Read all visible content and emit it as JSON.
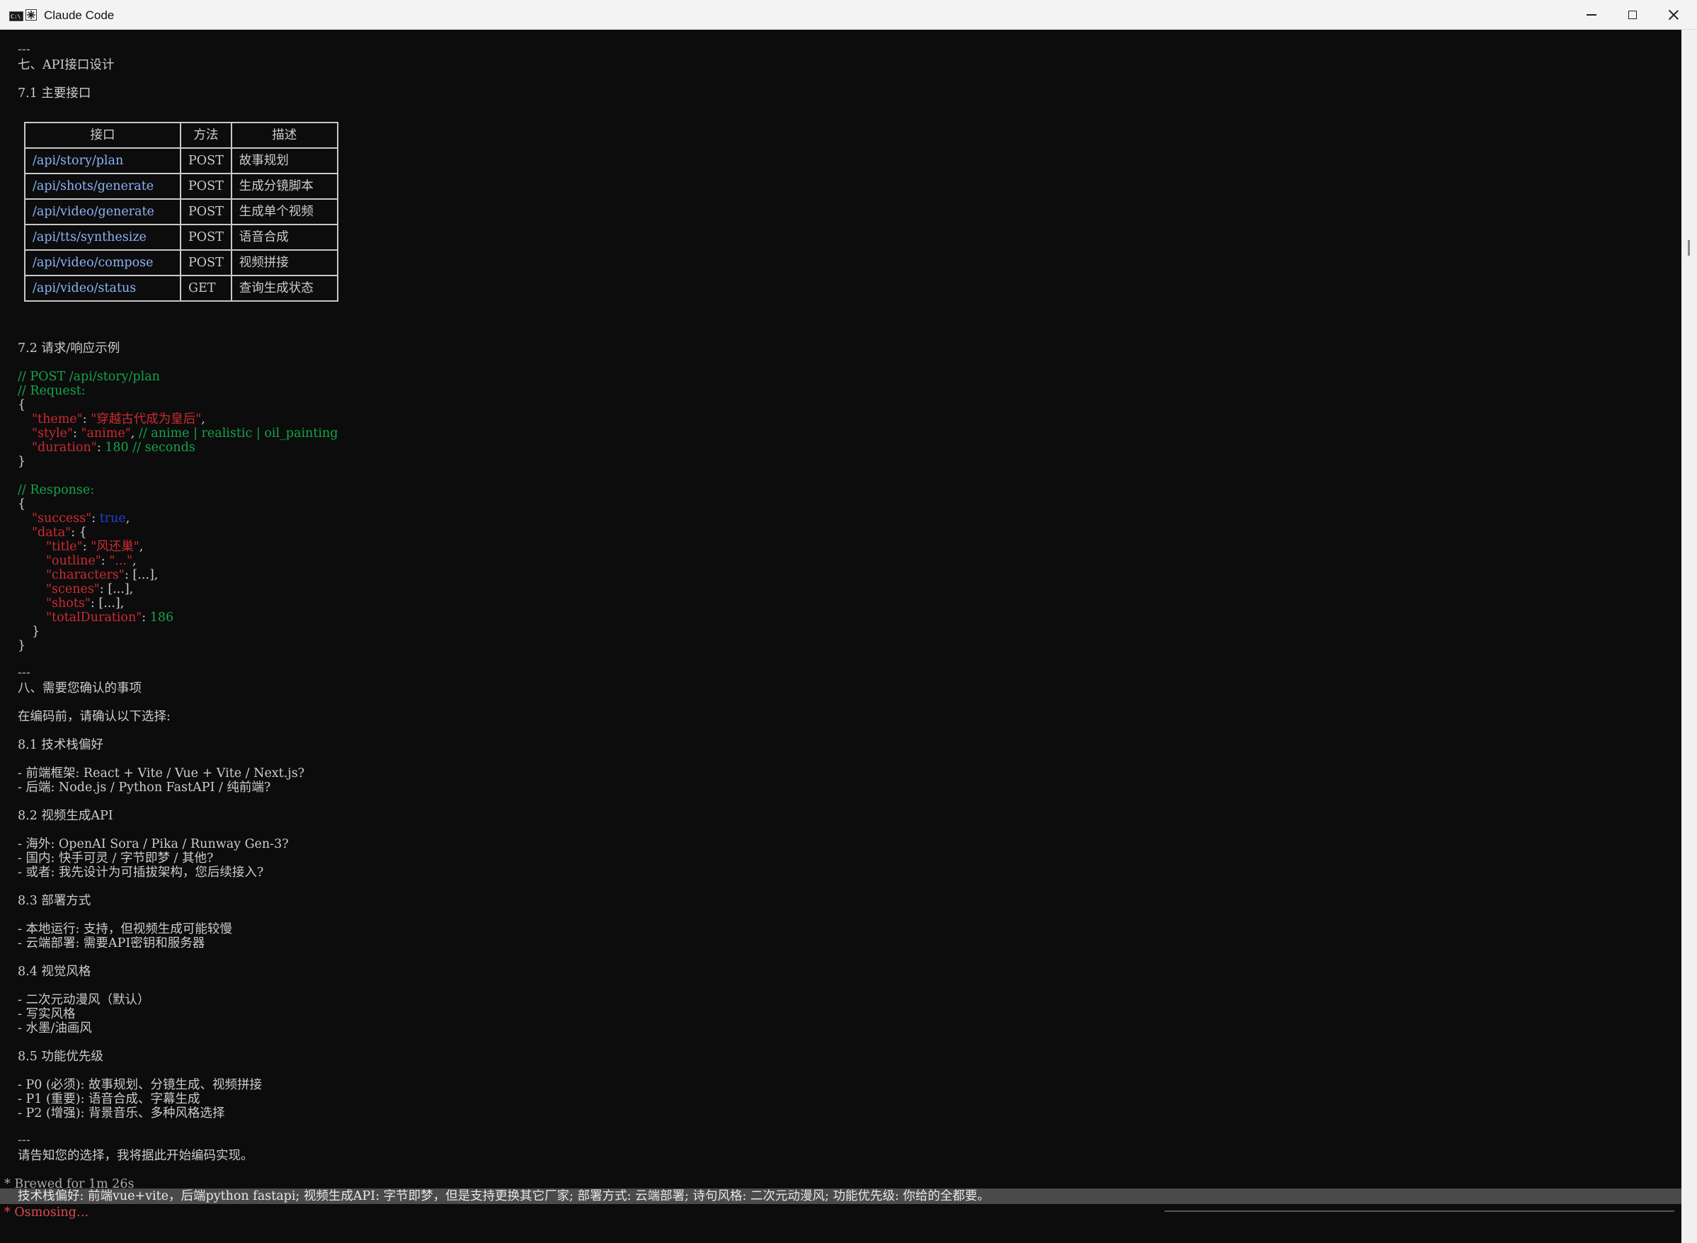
{
  "window": {
    "title": "Claude Code",
    "app_icon": "cmd-icon",
    "logo_icon": "sparkle-icon"
  },
  "lines": {
    "hr1": "---",
    "sec7": "七、API接口设计",
    "sec71": "7.1 主要接口",
    "sec72": "7.2 请求/响应示例",
    "hr2": "---",
    "sec8": "八、需要您确认的事项",
    "intro8": "在编码前，请确认以下选择:",
    "sec81": "8.1 技术栈偏好",
    "l81a": "- 前端框架: React + Vite / Vue + Vite / Next.js?",
    "l81b": "- 后端: Node.js / Python FastAPI / 纯前端?",
    "sec82": "8.2 视频生成API",
    "l82a": "- 海外: OpenAI Sora / Pika / Runway Gen-3?",
    "l82b": "- 国内: 快手可灵 / 字节即梦 / 其他?",
    "l82c": "- 或者: 我先设计为可插拔架构，您后续接入?",
    "sec83": "8.3 部署方式",
    "l83a": "- 本地运行: 支持，但视频生成可能较慢",
    "l83b": "- 云端部署: 需要API密钥和服务器",
    "sec84": "8.4 视觉风格",
    "l84a": "- 二次元动漫风（默认）",
    "l84b": "- 写实风格",
    "l84c": "- 水墨/油画风",
    "sec85": "8.5 功能优先级",
    "l85a": "- P0 (必须): 故事规划、分镜生成、视频拼接",
    "l85b": "- P1 (重要): 语音合成、字幕生成",
    "l85c": "- P2 (增强): 背景音乐、多种风格选择",
    "hr3": "---",
    "closing": "请告知您的选择，我将据此开始编码实现。",
    "brewed": "Brewed for 1m 26s",
    "status": "Osmosing…"
  },
  "table": {
    "headers": [
      "接口",
      "方法",
      "描述"
    ],
    "rows": [
      [
        "/api/story/plan",
        "POST",
        "故事规划"
      ],
      [
        "/api/shots/generate",
        "POST",
        "生成分镜脚本"
      ],
      [
        "/api/video/generate",
        "POST",
        "生成单个视频"
      ],
      [
        "/api/tts/synthesize",
        "POST",
        "语音合成"
      ],
      [
        "/api/video/compose",
        "POST",
        "视频拼接"
      ],
      [
        "/api/video/status",
        "GET",
        "查询生成状态"
      ]
    ]
  },
  "code": {
    "c1": "// POST /api/story/plan",
    "c2": "// Request:",
    "brace_open": "{",
    "brace_close": "}",
    "theme_key": "\"theme\"",
    "theme_val": "\"穿越古代成为皇后\"",
    "style_key": "\"style\"",
    "style_val": "\"anime\"",
    "style_comment": "// anime | realistic | oil_painting",
    "duration_key": "\"duration\"",
    "duration_val": "180",
    "duration_comment": "// seconds",
    "c3": "// Response:",
    "success_key": "\"success\"",
    "success_val": "true",
    "data_key": "\"data\"",
    "title_key": "\"title\"",
    "title_val": "\"风还巢\"",
    "outline_key": "\"outline\"",
    "outline_val": "\"...\"",
    "characters_key": "\"characters\"",
    "scenes_key": "\"scenes\"",
    "shots_key": "\"shots\"",
    "ellipsis_arr": "[...]",
    "total_key": "\"totalDuration\"",
    "total_val": "186"
  },
  "input": {
    "value": "技术栈偏好: 前端vue+vite，后端python fastapi; 视频生成API: 字节即梦，但是支持更换其它厂家; 部署方式: 云端部署; 诗句风格: 二次元动漫风; 功能优先级: 你给的全都要。"
  },
  "colors": {
    "background": "#0c0c0c",
    "text": "#cccccc",
    "string": "#cc2b31",
    "comment": "#16a34a",
    "boolean": "#1e40c8",
    "path": "#8ab4f8"
  }
}
